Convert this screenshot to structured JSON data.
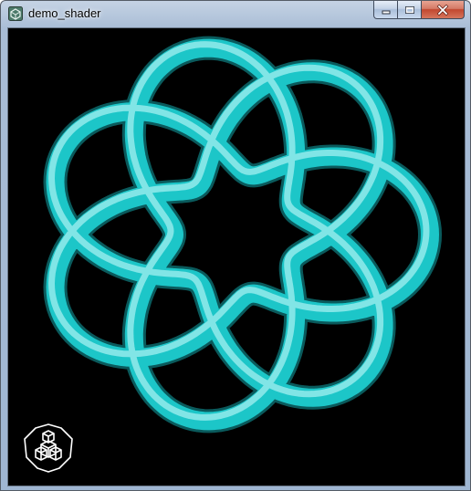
{
  "window": {
    "title": "demo_shader",
    "app_icon": "app-icon",
    "controls": [
      "minimize-icon",
      "maximize-icon",
      "close-icon"
    ]
  },
  "viewport": {
    "background": "#000000",
    "object": "torus-knot",
    "tube_color": "#1cc6c8",
    "highlight_color": "#d6ffff",
    "shadow_color": "#0a5a5c",
    "orientation_gizmo_icon": "axis-cube-icon"
  },
  "colors": {
    "titlebar": "#a9bdd6",
    "close_button": "#c2472f"
  }
}
